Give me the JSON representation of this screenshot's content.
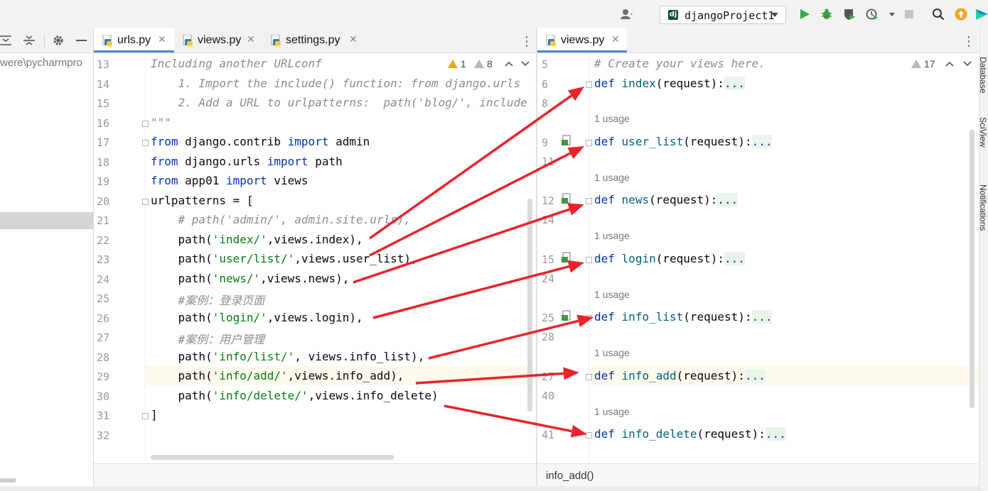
{
  "toolbar": {
    "run_config": "djangoProject1",
    "dj_badge": "dj"
  },
  "project": {
    "path_fragment": "were\\pycharmpro"
  },
  "left_tabs": [
    {
      "label": "urls.py",
      "active": true
    },
    {
      "label": "views.py",
      "active": false
    },
    {
      "label": "settings.py",
      "active": false
    }
  ],
  "right_tabs": [
    {
      "label": "views.py",
      "active": true
    }
  ],
  "left_editor": {
    "warnings": {
      "errors": "1",
      "weak": "8"
    },
    "line_numbers": [
      "13",
      "14",
      "15",
      "16",
      "17",
      "18",
      "19",
      "20",
      "21",
      "22",
      "23",
      "24",
      "25",
      "26",
      "27",
      "28",
      "29",
      "30",
      "31",
      "32"
    ],
    "lines": [
      "Including another URLconf",
      "    1. Import the include() function: from django.urls",
      "    2. Add a URL to urlpatterns:  path('blog/', include",
      "\"\"\"",
      "from django.contrib import admin",
      "from django.urls import path",
      "from app01 import views",
      "urlpatterns = [",
      "    # path('admin/', admin.site.urls),",
      "    path('index/',views.index),",
      "    path('user/list/',views.user_list),",
      "    path('news/',views.news),",
      "    #案例：登录页面",
      "    path('login/',views.login),",
      "    #案例：用户管理",
      "    path('info/list/', views.info_list),",
      "    path('info/add/',views.info_add),",
      "    path('info/delete/',views.info_delete)",
      "]",
      ""
    ]
  },
  "right_editor": {
    "warnings": {
      "weak": "17"
    },
    "usage_label": "1 usage",
    "rows": [
      {
        "ln": "5",
        "text": "# Create your views here."
      },
      {
        "ln": "6",
        "def": "def",
        "name": "index",
        "args": "(request):",
        "fold": "..."
      },
      {
        "ln": "8"
      },
      {
        "ln": "9",
        "def": "def",
        "name": "user_list",
        "args": "(request):",
        "fold": "..."
      },
      {
        "ln": "11"
      },
      {
        "ln": "12",
        "def": "def",
        "name": "news",
        "args": "(request):",
        "fold": "..."
      },
      {
        "ln": "14"
      },
      {
        "ln": "15",
        "def": "def",
        "name": "login",
        "args": "(request):",
        "fold": "..."
      },
      {
        "ln": "24"
      },
      {
        "ln": "25",
        "def": "def",
        "name": "info_list",
        "args": "(request):",
        "fold": "..."
      },
      {
        "ln": "28"
      },
      {
        "ln": "27",
        "def": "def",
        "name": "info_add",
        "args": "(request):",
        "fold": "..."
      },
      {
        "ln": "40"
      },
      {
        "ln": "41",
        "def": "def",
        "name": "info_delete",
        "args": "(request):",
        "fold": "..."
      }
    ]
  },
  "breadcrumb": "info_add()",
  "right_strip": {
    "database": "Database",
    "sciview": "SciView",
    "notifications": "Notifications"
  },
  "colors": {
    "keyword": "#0033b3",
    "string": "#067d17",
    "comment": "#8c8c8c",
    "arrow": "#e8232b",
    "active_tab": "#4a88c7"
  }
}
